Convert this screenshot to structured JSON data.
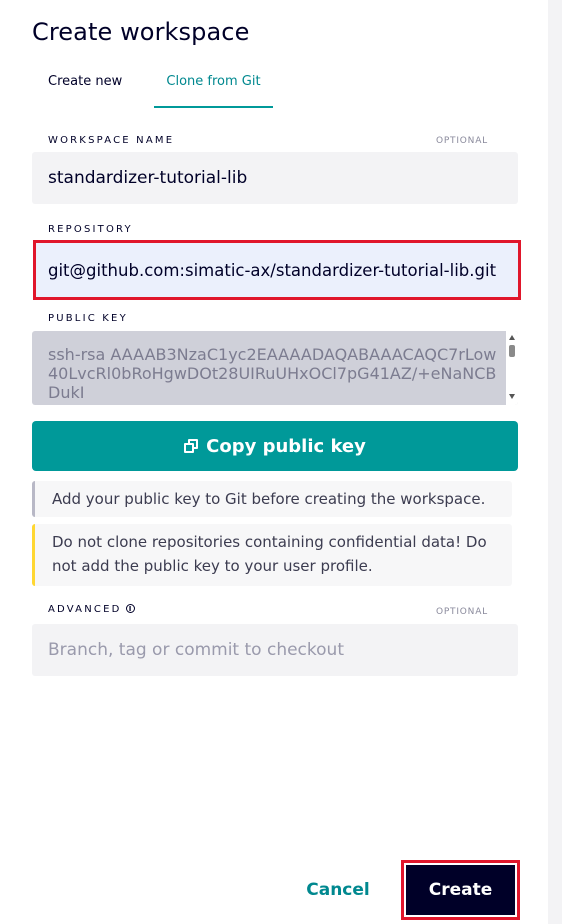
{
  "dialog": {
    "title": "Create workspace",
    "tabs": [
      {
        "label": "Create new",
        "active": false
      },
      {
        "label": "Clone from Git",
        "active": true
      }
    ]
  },
  "workspace_name": {
    "label": "WORKSPACE NAME",
    "optional": "OPTIONAL",
    "value": "standardizer-tutorial-lib"
  },
  "repository": {
    "label": "REPOSITORY",
    "value": "git@github.com:simatic-ax/standardizer-tutorial-lib.git"
  },
  "public_key": {
    "label": "PUBLIC KEY",
    "value": "ssh-rsa AAAAB3NzaC1yc2EAAAADAQABAAACAQC7rLow40LvcRl0bRoHgwDOt28UIRuUHxOCl7pG41AZ/+eNaNCBDukI",
    "copy_button": "Copy public key"
  },
  "notes": {
    "info": "Add your public key to Git before creating the workspace.",
    "warning": "Do not clone repositories containing confidential data! Do not add the public key to your user profile."
  },
  "advanced": {
    "label": "ADVANCED",
    "optional": "OPTIONAL",
    "placeholder": "Branch, tag or commit to checkout",
    "value": ""
  },
  "footer": {
    "cancel": "Cancel",
    "create": "Create"
  },
  "colors": {
    "accent": "#009999",
    "highlight_border": "#e0162b",
    "primary_button": "#000028",
    "warning_bar": "#ffd732"
  }
}
